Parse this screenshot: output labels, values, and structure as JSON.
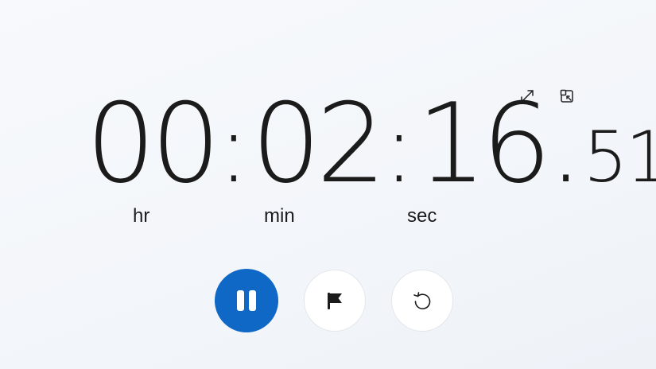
{
  "timer": {
    "hours": "00",
    "sep1": ":",
    "minutes": "02",
    "sep2": ":",
    "seconds": "16",
    "dot": ".",
    "centiseconds": "51"
  },
  "units": {
    "hr": "hr",
    "min": "min",
    "sec": "sec"
  },
  "icons": {
    "expand": "expand-icon",
    "compact_overlay": "compact-overlay-icon",
    "pause": "pause-icon",
    "lap": "flag-icon",
    "reset": "reset-icon"
  },
  "colors": {
    "accent": "#0f67c6",
    "text": "#1b1b1b",
    "background": "#f5f7fa"
  }
}
